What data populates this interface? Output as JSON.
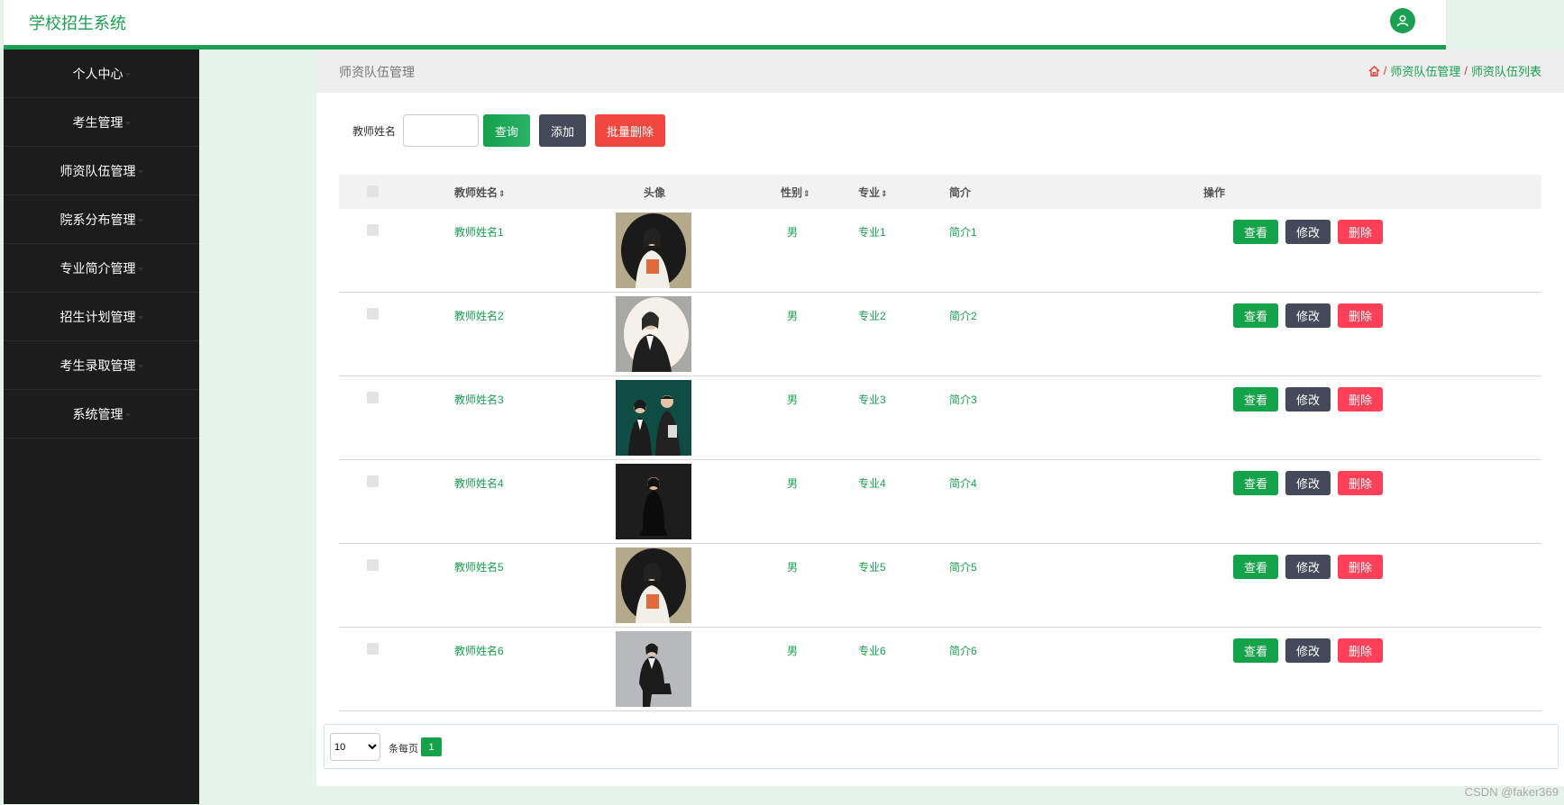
{
  "app": {
    "title": "学校招生系统"
  },
  "colors": {
    "accent": "#1aa050",
    "sidebar": "#1c1c1c",
    "danger": "#ff4057",
    "dark_button": "#444a5a"
  },
  "sidebar": {
    "items": [
      {
        "label": "个人中心"
      },
      {
        "label": "考生管理"
      },
      {
        "label": "师资队伍管理"
      },
      {
        "label": "院系分布管理"
      },
      {
        "label": "专业简介管理"
      },
      {
        "label": "招生计划管理"
      },
      {
        "label": "考生录取管理"
      },
      {
        "label": "系统管理"
      }
    ]
  },
  "page": {
    "title": "师资队伍管理",
    "breadcrumb": {
      "home_icon": "home-icon",
      "sep": "/",
      "level1": "师资队伍管理",
      "level2": "师资队伍列表"
    }
  },
  "search": {
    "label": "教师姓名",
    "value": "",
    "query_btn": "查询",
    "add_btn": "添加",
    "batch_delete_btn": "批量删除"
  },
  "table": {
    "headers": {
      "name": "教师姓名",
      "avatar": "头像",
      "gender": "性别",
      "major": "专业",
      "intro": "简介",
      "ops": "操作",
      "sort_icon": "⇕"
    },
    "rows": [
      {
        "name": "教师姓名1",
        "gender": "男",
        "major": "专业1",
        "intro": "简介1",
        "avatar": "female-teacher-oval"
      },
      {
        "name": "教师姓名2",
        "gender": "男",
        "major": "专业2",
        "intro": "简介2",
        "avatar": "female-teacher-oval-grey"
      },
      {
        "name": "教师姓名3",
        "gender": "男",
        "major": "专业3",
        "intro": "简介3",
        "avatar": "two-teachers-teal"
      },
      {
        "name": "教师姓名4",
        "gender": "男",
        "major": "专业4",
        "intro": "简介4",
        "avatar": "female-teacher-dark"
      },
      {
        "name": "教师姓名5",
        "gender": "男",
        "major": "专业5",
        "intro": "简介5",
        "avatar": "female-teacher-oval"
      },
      {
        "name": "教师姓名6",
        "gender": "男",
        "major": "专业6",
        "intro": "简介6",
        "avatar": "female-teacher-seated"
      }
    ],
    "actions": {
      "view": "查看",
      "edit": "修改",
      "delete": "删除"
    }
  },
  "pagination": {
    "page_size": "10",
    "per_page_label": "条每页",
    "current_page": "1"
  },
  "watermark": "CSDN @faker369"
}
